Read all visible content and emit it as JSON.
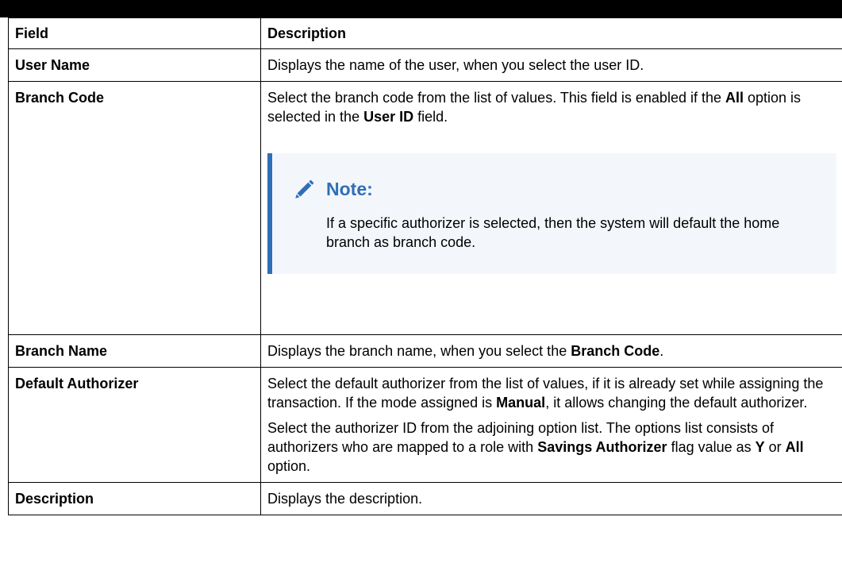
{
  "table": {
    "headers": [
      "Field",
      "Description"
    ],
    "rows": {
      "user_name": {
        "field": "User Name",
        "desc": "Displays the name of the user, when you select the user ID."
      },
      "branch_code": {
        "field": "Branch Code",
        "desc_1": "Select the branch code from the list of values. This field is enabled if the ",
        "desc_b1": "All",
        "desc_2": " option is selected in the ",
        "desc_b2": "User ID",
        "desc_3": " field.",
        "note_title": "Note:",
        "note_icon": "pencil-icon",
        "note_text": "If a specific authorizer is selected, then the system will default the home branch as branch code."
      },
      "branch_name": {
        "field": "Branch Name",
        "desc_1": "Displays the branch name, when you select the ",
        "desc_b1": "Branch Code",
        "desc_2": "."
      },
      "default_authorizer": {
        "field": "Default Authorizer",
        "p1_1": "Select the default authorizer from the list of values, if it is already set while assigning the transaction. If the mode assigned is ",
        "p1_b1": "Manual",
        "p1_2": ", it allows changing the default authorizer.",
        "p2_1": "Select the authorizer ID from the adjoining option list. The options list consists of authorizers who are mapped to a role with ",
        "p2_b1": "Savings Authorizer",
        "p2_2": " flag value as ",
        "p2_b2": "Y",
        "p2_3": " or ",
        "p2_b3": "All",
        "p2_4": " option."
      },
      "description": {
        "field": "Description",
        "desc": "Displays the description."
      }
    }
  },
  "colors": {
    "note_accent": "#2f6fb6",
    "note_background": "#f3f7fc",
    "top_bar": "#000000"
  }
}
